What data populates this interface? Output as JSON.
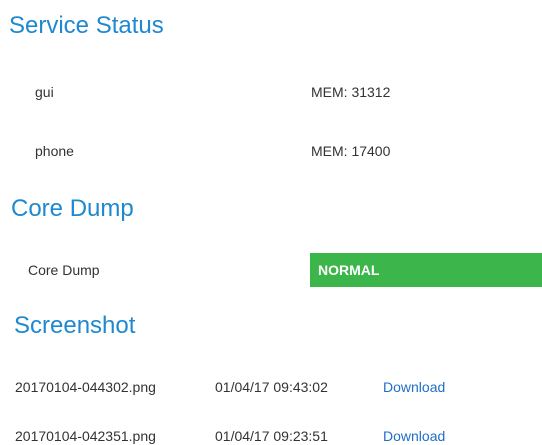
{
  "service_status": {
    "title": "Service Status",
    "items": [
      {
        "name": "gui",
        "mem": "MEM: 31312"
      },
      {
        "name": "phone",
        "mem": "MEM: 17400"
      }
    ]
  },
  "core_dump": {
    "title": "Core Dump",
    "label": "Core Dump",
    "status": "NORMAL",
    "status_color": "#3cb54a"
  },
  "screenshot": {
    "title": "Screenshot",
    "files": [
      {
        "filename": "20170104-044302.png",
        "datetime": "01/04/17 09:43:02",
        "action": "Download"
      },
      {
        "filename": "20170104-042351.png",
        "datetime": "01/04/17 09:23:51",
        "action": "Download"
      }
    ]
  },
  "colors": {
    "heading": "#1e88d0",
    "link": "#1e6fc8",
    "text": "#333333"
  }
}
